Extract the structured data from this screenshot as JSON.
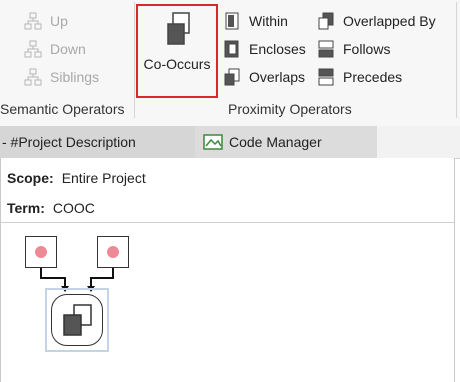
{
  "ribbon": {
    "semantic": {
      "label": "Semantic Operators",
      "items": [
        {
          "label": "Up",
          "icon": "tree-up-icon"
        },
        {
          "label": "Down",
          "icon": "tree-down-icon"
        },
        {
          "label": "Siblings",
          "icon": "tree-siblings-icon"
        }
      ]
    },
    "proximity": {
      "label": "Proximity Operators",
      "cooccurs": {
        "label": "Co-Occurs",
        "icon": "co-occurs-icon"
      },
      "col1": [
        {
          "label": "Within",
          "icon": "within-icon"
        },
        {
          "label": "Encloses",
          "icon": "encloses-icon"
        },
        {
          "label": "Overlaps",
          "icon": "overlaps-icon"
        }
      ],
      "col2": [
        {
          "label": "Overlapped By",
          "icon": "overlapped-by-icon"
        },
        {
          "label": "Follows",
          "icon": "follows-icon"
        },
        {
          "label": "Precedes",
          "icon": "precedes-icon"
        }
      ]
    }
  },
  "tabs": {
    "tab1": "- #Project Description",
    "tab2": "Code Manager"
  },
  "query": {
    "scope_label": "Scope:",
    "scope_value": "Entire Project",
    "term_label": "Term:",
    "term_value": "COOC"
  },
  "colors": {
    "highlight": "#d42a2a",
    "node_dot": "#ee8a96"
  }
}
